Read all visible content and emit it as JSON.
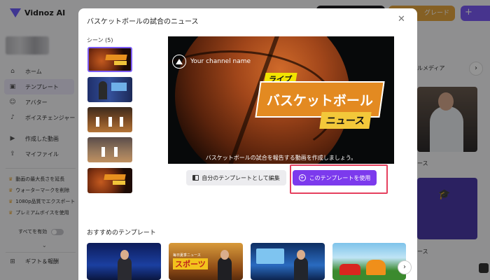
{
  "app": {
    "logo_text": "Vidnoz AI",
    "logo_badge": "",
    "upgrade_label": "グレード",
    "upgrade_color": "#e6a53e",
    "accent_color": "#7c3aed"
  },
  "sidebar": {
    "items": [
      {
        "icon": "home-icon",
        "glyph": "⌂",
        "label": "ホーム"
      },
      {
        "icon": "briefcase-icon",
        "glyph": "▣",
        "label": "テンプレート"
      },
      {
        "icon": "avatar-icon",
        "glyph": "☺",
        "label": "アバター"
      },
      {
        "icon": "voice-changer-icon",
        "glyph": "♪",
        "label": "ボイスチェンジャー"
      },
      {
        "icon": "video-icon",
        "glyph": "▶",
        "label": "作成した動画"
      },
      {
        "icon": "upload-icon",
        "glyph": "⇪",
        "label": "マイファイル"
      }
    ],
    "perks": [
      "動画の最大長さを延長",
      "ウォーターマークを削除",
      "1080p品質でエクスポート",
      "プレミアムボイスを使用"
    ],
    "enable_all_label": "すべてを有効",
    "gift_label": "ギフト＆報酬"
  },
  "background": {
    "media_label": "ルメディア",
    "card_label_1": "ース",
    "card_label_2": "ース"
  },
  "modal": {
    "title": "バスケットボールの試合のニュース",
    "scene_label": "シーン (5)",
    "scene_count": 5,
    "preview": {
      "channel_name": "Your channel name",
      "live_tag": "ライブ",
      "headline": "バスケットボール",
      "subheadline": "ニュース",
      "caption": "バスケットボールの試合を報告する動画を作成しましょう。"
    },
    "edit_button_label": "自分のテンプレートとして編集",
    "use_button_label": "このテンプレートを使用",
    "recommended_label": "おすすめのテンプレート",
    "recommended_sports_text": "スポーツ",
    "recommended_sports_sub": "毎日夏季ニュース"
  }
}
